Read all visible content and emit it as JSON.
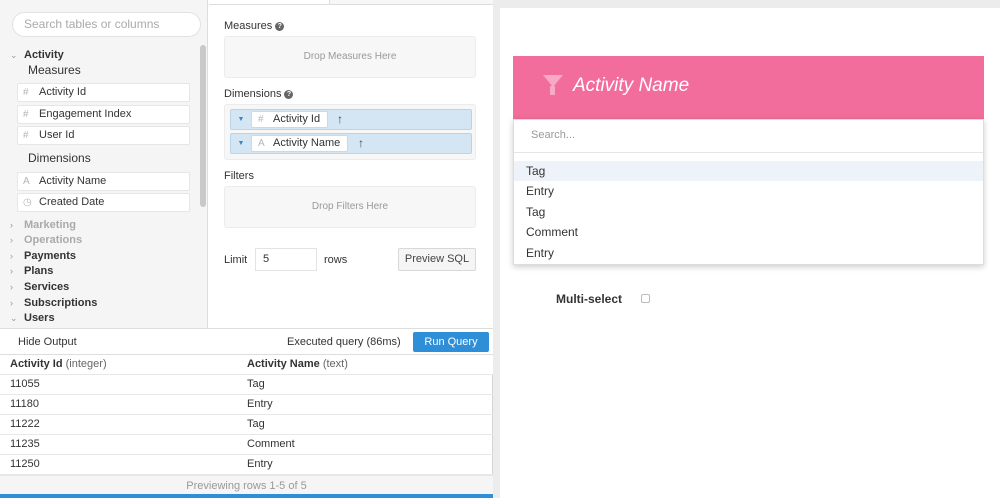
{
  "schema": {
    "search_placeholder": "Search tables or columns",
    "activity": {
      "label": "Activity",
      "measures_label": "Measures",
      "measures": [
        "Activity Id",
        "Engagement Index",
        "User Id"
      ],
      "dimensions_label": "Dimensions",
      "dimensions": [
        "Activity Name",
        "Created Date"
      ]
    },
    "tables": [
      {
        "label": "Marketing",
        "dim": true
      },
      {
        "label": "Operations",
        "dim": true
      },
      {
        "label": "Payments",
        "dim": false
      },
      {
        "label": "Plans",
        "dim": false
      },
      {
        "label": "Services",
        "dim": false
      },
      {
        "label": "Subscriptions",
        "dim": false
      },
      {
        "label": "Users",
        "dim": false
      }
    ]
  },
  "builder": {
    "measures_label": "Measures",
    "measures_drop": "Drop Measures Here",
    "dimensions_label": "Dimensions",
    "dimensions": [
      {
        "label": "Activity Id",
        "icon": "#"
      },
      {
        "label": "Activity Name",
        "icon": "A"
      }
    ],
    "filters_label": "Filters",
    "filters_drop": "Drop Filters Here",
    "limit_label": "Limit",
    "limit_value": "5",
    "rows_label": "rows",
    "preview_sql": "Preview SQL"
  },
  "output": {
    "hide_output": "Hide Output",
    "executed": "Executed query (86ms)",
    "run_query": "Run Query",
    "columns": [
      {
        "name": "Activity Id",
        "type": "(integer)"
      },
      {
        "name": "Activity Name",
        "type": "(text)"
      }
    ],
    "rows": [
      [
        "11055",
        "Tag"
      ],
      [
        "11180",
        "Entry"
      ],
      [
        "11222",
        "Tag"
      ],
      [
        "11235",
        "Comment"
      ],
      [
        "11250",
        "Entry"
      ]
    ],
    "footer": "Previewing rows 1-5 of 5"
  },
  "filter_panel": {
    "title": "Activity Name",
    "search_placeholder": "Search...",
    "options": [
      "Tag",
      "Entry",
      "Tag",
      "Comment",
      "Entry"
    ],
    "multiselect_label": "Multi-select",
    "accent": "#f26d9b"
  }
}
